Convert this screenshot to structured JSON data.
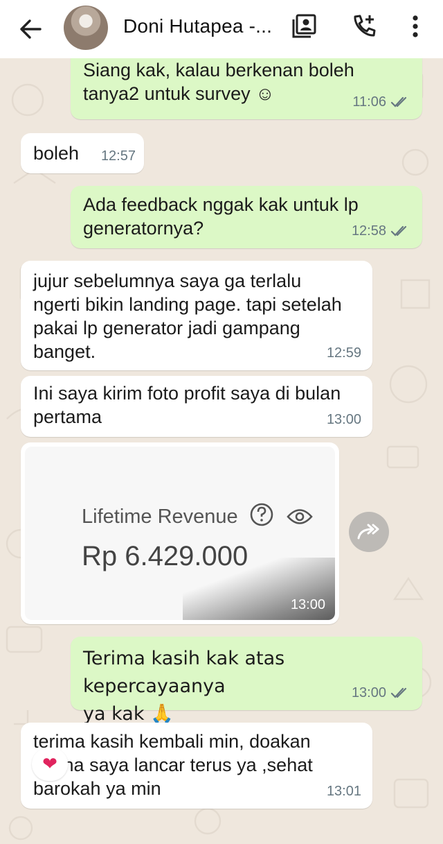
{
  "header": {
    "contact_name": "Doni Hutapea -...",
    "icons": [
      "back-arrow-icon",
      "contact-card-icon",
      "add-call-icon",
      "more-vert-icon"
    ]
  },
  "messages": [
    {
      "direction": "out",
      "text": "Siang kak, kalau berkenan boleh\ntanya2 untuk survey ☺",
      "time": "11:06",
      "status": "read"
    },
    {
      "direction": "in",
      "text": "boleh",
      "time": "12:57"
    },
    {
      "direction": "out",
      "text": "Ada feedback nggak kak untuk lp\ngeneratornya?",
      "time": "12:58",
      "status": "read"
    },
    {
      "direction": "in",
      "text": "jujur sebelumnya saya ga terlalu\nngerti bikin landing page. tapi setelah\npakai lp generator jadi gampang\nbanget.",
      "time": "12:59"
    },
    {
      "direction": "in",
      "text": "Ini saya kirim foto profit saya di bulan\npertama",
      "time": "13:00"
    },
    {
      "direction": "in",
      "type": "image",
      "image_label": "Lifetime Revenue",
      "image_value": "Rp 6.429.000",
      "time": "13:00"
    },
    {
      "direction": "out",
      "text": "Terima kasih kak atas kepercayaanya\nya kak 🙏",
      "time": "13:00",
      "status": "read"
    },
    {
      "direction": "in",
      "text": "terima kasih kembali min, doakan\nusaha saya lancar terus ya ,sehat\nbarokah ya min",
      "time": "13:01",
      "reaction": "❤"
    }
  ],
  "colors": {
    "outgoing_bubble": "#dcf8c6",
    "incoming_bubble": "#ffffff",
    "chat_background": "#efe7dd",
    "read_ticks": "#667781"
  }
}
